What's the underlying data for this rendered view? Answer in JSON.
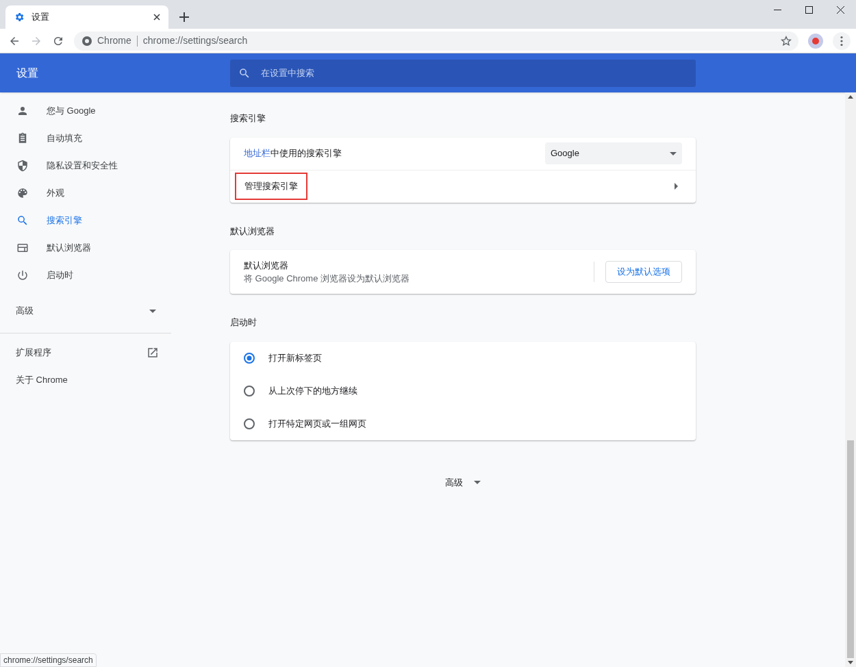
{
  "tab": {
    "title": "设置"
  },
  "address_bar": {
    "site_label": "Chrome",
    "url": "chrome://settings/search"
  },
  "header": {
    "title": "设置",
    "search_placeholder": "在设置中搜索"
  },
  "sidebar": {
    "items": [
      {
        "label": "您与 Google",
        "selected": false
      },
      {
        "label": "自动填充",
        "selected": false
      },
      {
        "label": "隐私设置和安全性",
        "selected": false
      },
      {
        "label": "外观",
        "selected": false
      },
      {
        "label": "搜索引擎",
        "selected": true
      },
      {
        "label": "默认浏览器",
        "selected": false
      },
      {
        "label": "启动时",
        "selected": false
      }
    ],
    "advanced": {
      "label": "高级",
      "expanded": false
    },
    "links": [
      {
        "label": "扩展程序",
        "external": true
      },
      {
        "label": "关于 Chrome",
        "external": false
      }
    ]
  },
  "search_engine": {
    "title": "搜索引擎",
    "link": "地址栏",
    "label": "中使用的搜索引擎",
    "value": "Google",
    "manage": {
      "label": "管理搜索引擎",
      "highlighted": true
    }
  },
  "default_browser": {
    "title": "默认浏览器",
    "label": "默认浏览器",
    "description": "将 Google Chrome 浏览器设为默认浏览器",
    "button": "设为默认选项"
  },
  "startup": {
    "title": "启动时",
    "options": [
      {
        "label": "打开新标签页",
        "selected": true
      },
      {
        "label": "从上次停下的地方继续",
        "selected": false
      },
      {
        "label": "打开特定网页或一组网页",
        "selected": false
      }
    ]
  },
  "advanced_toggle": {
    "label": "高级",
    "expanded": false
  },
  "status_bubble": "chrome://settings/search"
}
